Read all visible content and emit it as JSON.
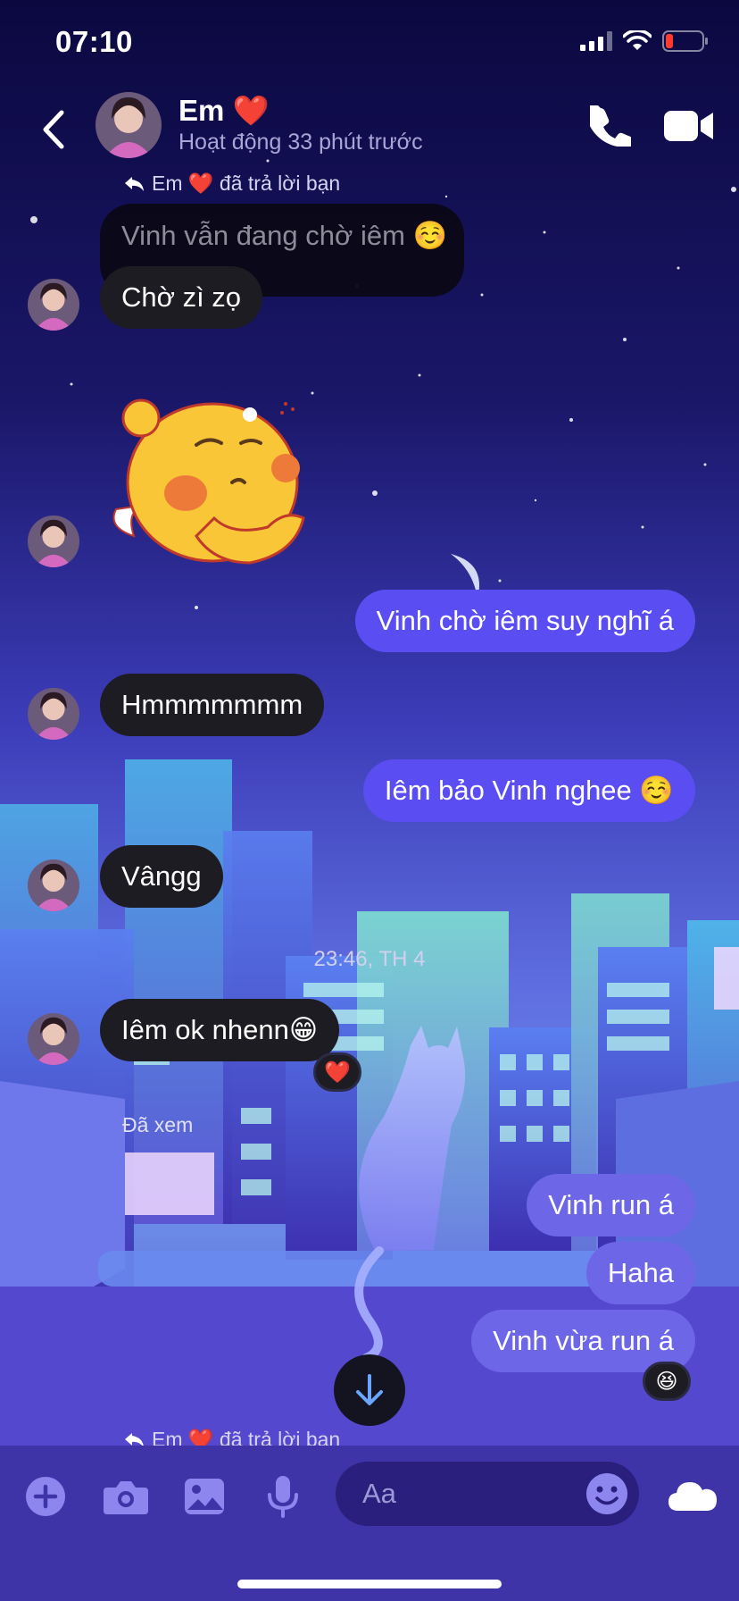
{
  "status_bar": {
    "time": "07:10"
  },
  "header": {
    "contact_name": "Em ❤️",
    "active_status": "Hoạt động 33 phút trước"
  },
  "conversation": {
    "reply_note_top": "Em ❤️ đã trả lời bạn",
    "quoted_message": "Vinh vẫn đang chờ iêm ☺️",
    "messages": [
      {
        "from": "them",
        "text": "Chờ zì zọ"
      },
      {
        "from": "them",
        "type": "sticker",
        "sticker": "yellow-chick-sticker"
      },
      {
        "from": "me",
        "text": "Vinh chờ iêm suy nghĩ á"
      },
      {
        "from": "them",
        "text": "Hmmmmmmm"
      },
      {
        "from": "me",
        "text": "Iêm bảo Vinh nghee ☺️"
      },
      {
        "from": "them",
        "text": "Vângg"
      },
      {
        "from": "them",
        "text": "Iêm ok nhenn😁",
        "reaction": "❤️"
      },
      {
        "from": "me",
        "text": "Vinh run á"
      },
      {
        "from": "me",
        "text": "Haha"
      },
      {
        "from": "me",
        "text": "Vinh vừa run á",
        "reaction": "😆"
      }
    ],
    "timestamp": "23:46, TH 4",
    "seen_label": "Đã xem",
    "reply_note_bottom": "Em ❤️ đã trả lời bạn"
  },
  "composer": {
    "placeholder": "Aa",
    "icons": [
      "plus-icon",
      "camera-icon",
      "image-icon",
      "microphone-icon",
      "emoji-icon",
      "cloud-icon"
    ]
  },
  "colors": {
    "outgoing_bubble": "#5a4ef2",
    "incoming_bubble": "#1c1c22",
    "composer_bar": "#3f33a8",
    "header_bg": "#0d0a4a"
  }
}
